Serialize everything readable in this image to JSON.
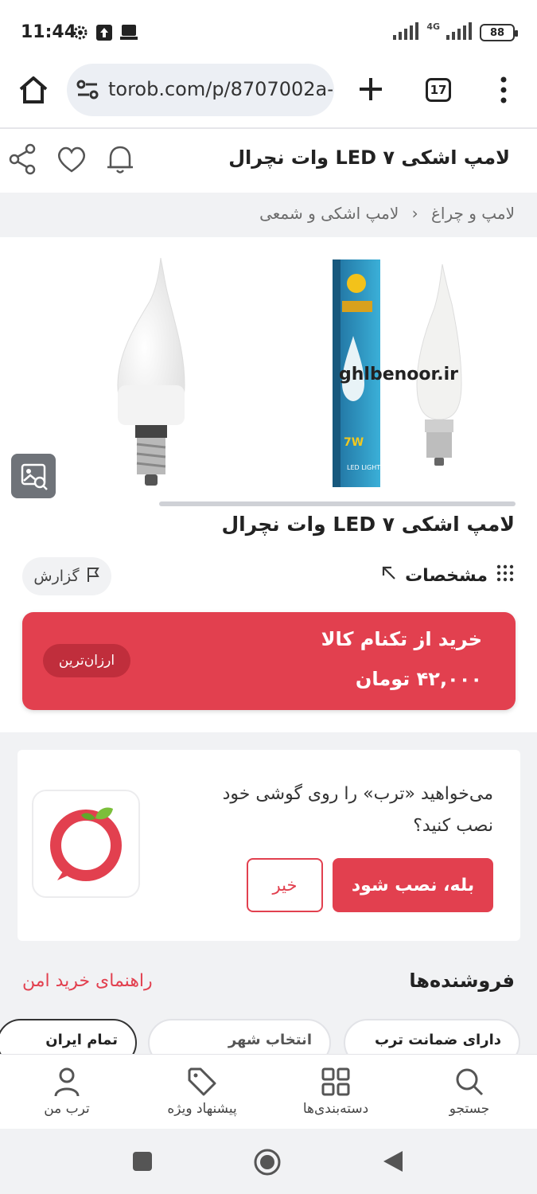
{
  "status_bar": {
    "time": "11:44",
    "network": "4G",
    "battery": "88"
  },
  "browser": {
    "url": "torob.com/p/8707002a-9",
    "tab_count": "17"
  },
  "product": {
    "header_title": "لامپ اشکی LED ۷ وات نچرال",
    "title": "لامپ اشکی LED ۷ وات نچرال",
    "image_watermark": "ghlbenoor.ir",
    "box_text": "7W",
    "box_brand": "LED LIGHT"
  },
  "breadcrumb": {
    "items": [
      "لامپ و چراغ",
      "لامپ اشکی و شمعی"
    ]
  },
  "actions": {
    "specs_label": "مشخصات",
    "report_label": "گزارش"
  },
  "offer": {
    "shop": "خرید از تکنام کالا",
    "price": "۴۲,۰۰۰ تومان",
    "badge": "ارزان‌ترین"
  },
  "install_prompt": {
    "question": "می‌خواهید «ترب» را روی گوشی خود نصب کنید؟",
    "yes_label": "بله، نصب شود",
    "no_label": "خیر"
  },
  "sellers": {
    "heading": "فروشنده‌ها",
    "guide_link": "راهنمای خرید امن",
    "chips": [
      "دارای ضمانت ترب",
      "انتخاب شهر",
      "تمام ایران"
    ]
  },
  "bottom_nav": {
    "items": [
      "جستجو",
      "دسته‌بندی‌ها",
      "پیشنهاد ویژه",
      "ترب من"
    ]
  },
  "colors": {
    "accent": "#e2404f",
    "page_gray": "#f1f2f4"
  }
}
